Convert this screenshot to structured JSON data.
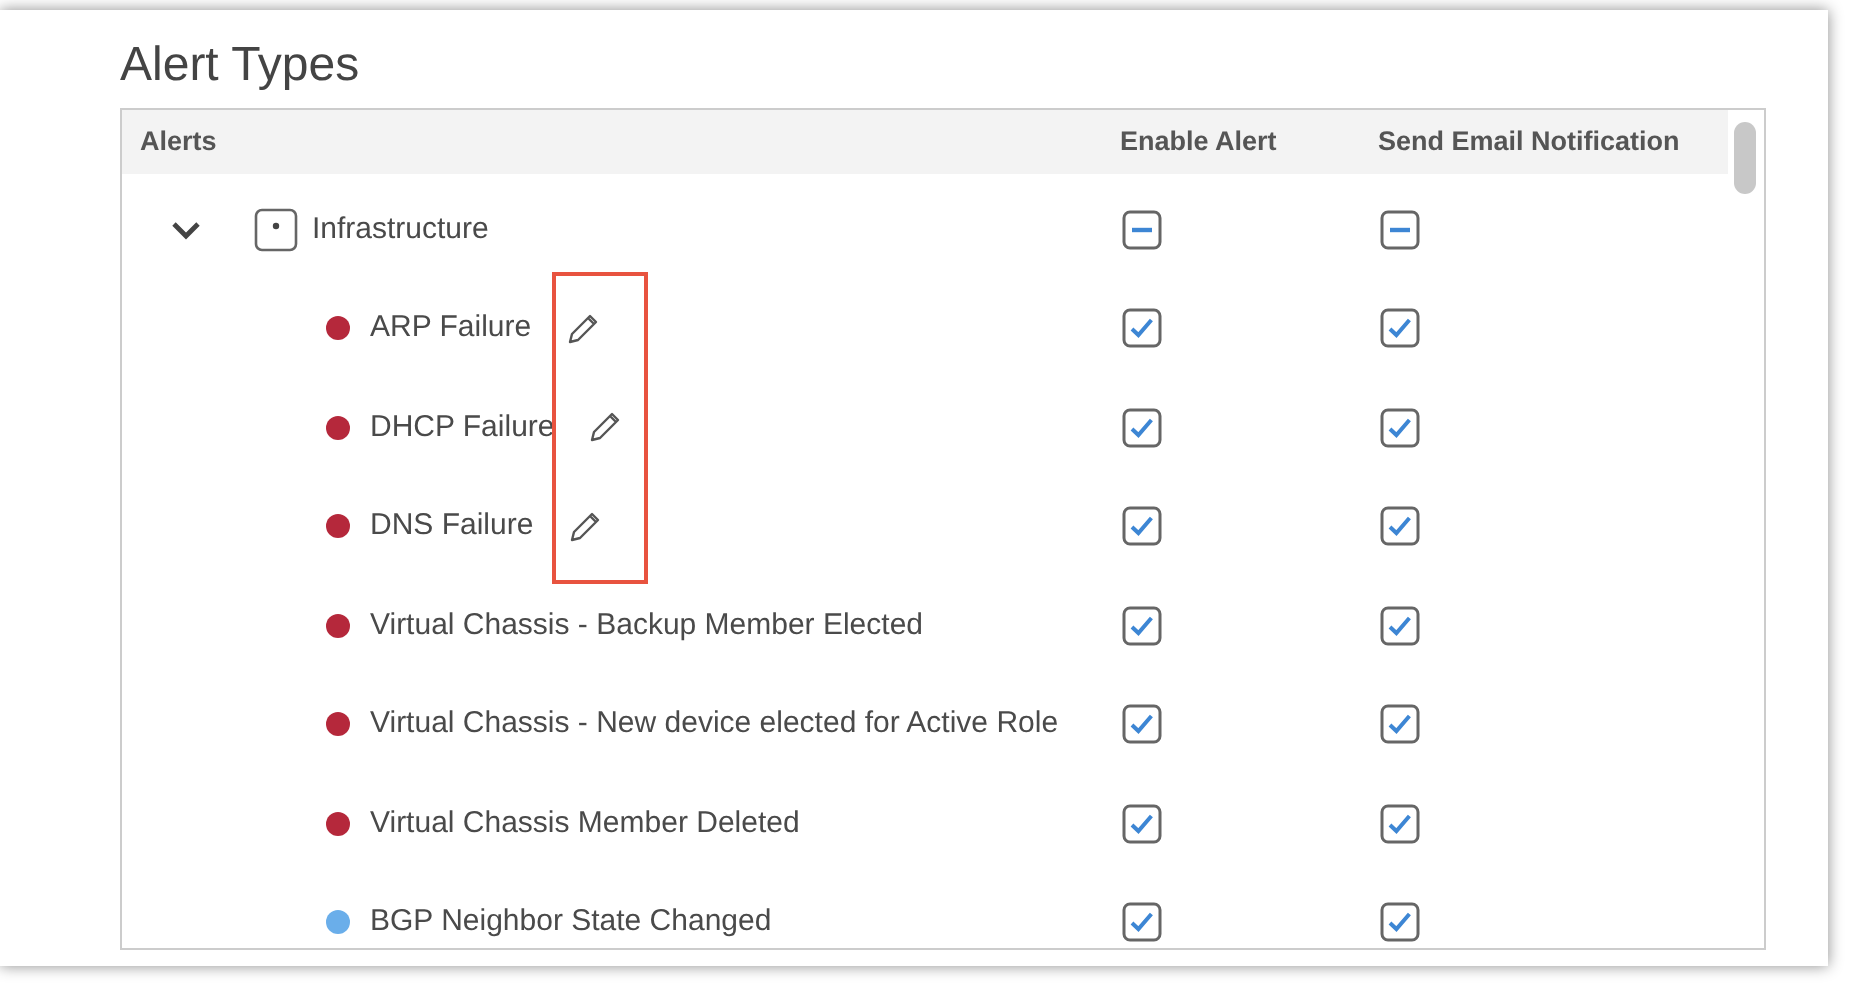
{
  "title": "Alert Types",
  "table": {
    "columns": [
      "Alerts",
      "Enable Alert",
      "Send Email Notification"
    ],
    "highlight_edit_icons": true,
    "groups": [
      {
        "label": "Infrastructure",
        "expanded": true,
        "enable": {
          "indeterminate": true
        },
        "email": {
          "indeterminate": true
        },
        "children": [
          {
            "label": "ARP Failure",
            "color": "#b5283b",
            "edit_icon": true,
            "enable": {
              "checked": true
            },
            "email": {
              "checked": true
            }
          },
          {
            "label": "DHCP Failure",
            "color": "#b5283b",
            "edit_icon": true,
            "enable": {
              "checked": true
            },
            "email": {
              "checked": true
            }
          },
          {
            "label": "DNS Failure",
            "color": "#b5283b",
            "edit_icon": true,
            "enable": {
              "checked": true
            },
            "email": {
              "checked": true
            }
          },
          {
            "label": "Virtual Chassis - Backup Member Elected",
            "color": "#b5283b",
            "edit_icon": false,
            "enable": {
              "checked": true
            },
            "email": {
              "checked": true
            }
          },
          {
            "label": "Virtual Chassis - New device elected for Active Role",
            "color": "#b5283b",
            "edit_icon": false,
            "enable": {
              "checked": true
            },
            "email": {
              "checked": true
            }
          },
          {
            "label": "Virtual Chassis Member Deleted",
            "color": "#b5283b",
            "edit_icon": false,
            "enable": {
              "checked": true
            },
            "email": {
              "checked": true
            }
          },
          {
            "label": "BGP Neighbor State Changed",
            "color": "#6aaeea",
            "edit_icon": false,
            "enable": {
              "checked": true
            },
            "email": {
              "checked": true
            }
          }
        ]
      }
    ]
  }
}
